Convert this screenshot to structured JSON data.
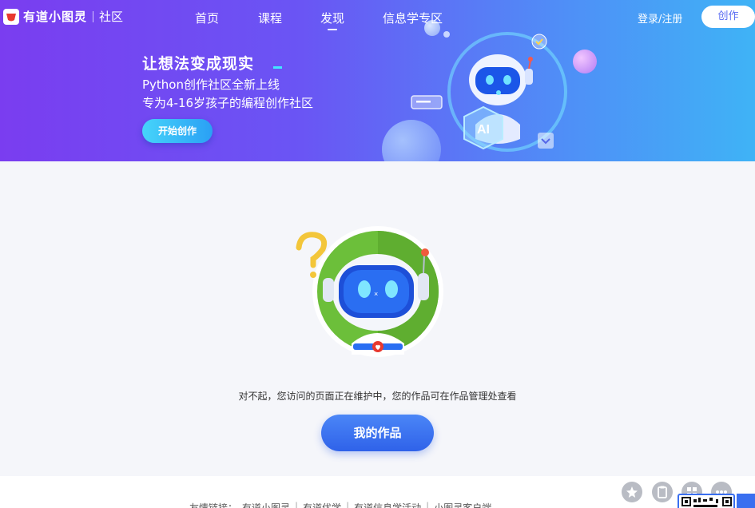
{
  "brand": {
    "name": "有道小图灵",
    "section": "社区"
  },
  "nav": {
    "items": [
      "首页",
      "课程",
      "发现",
      "信息学专区"
    ],
    "active_index": 2,
    "login": "登录/注册",
    "create": "创作"
  },
  "banner": {
    "title": "让想法变成现实",
    "line1": "Python创作社区全新上线",
    "line2": "专为4-16岁孩子的编程创作社区",
    "cta": "开始创作"
  },
  "main": {
    "message": "对不起，您访问的页面正在维护中，您的作品可在作品管理处查看",
    "button": "我的作品"
  },
  "footer": {
    "label": "友情链接：",
    "links": [
      "有道小图灵",
      "有道优学",
      "有道信息学活动",
      "小图灵客户端"
    ]
  },
  "colors": {
    "accent": "#3a6ff0",
    "banner_start": "#7a3df0",
    "banner_end": "#3fb3f6",
    "robot_ring": "#6cbf3a"
  },
  "icons": [
    "logo-icon",
    "star-icon",
    "clipboard-icon",
    "grid-icon",
    "more-icon",
    "qr-code-icon"
  ]
}
